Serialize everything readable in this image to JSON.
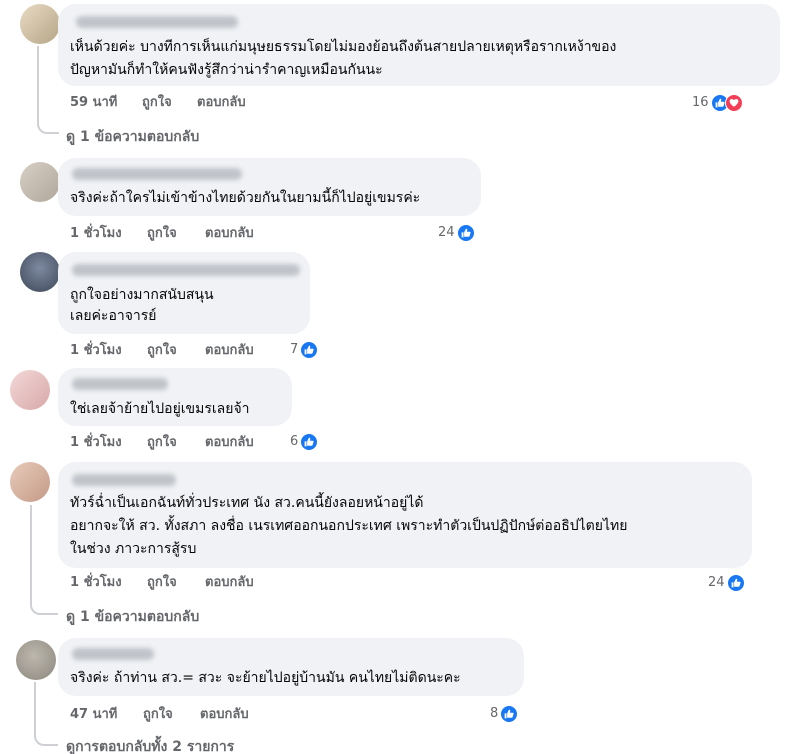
{
  "comments": [
    {
      "avatar_color": "#c9b89a",
      "lines": [
        "เห็นด้วยค่ะ บางทีการเห็นแก่มนุษยธรรมโดยไม่มองย้อนถึงต้นสายปลายเหตุหรือรากเหง้าของ",
        "ปัญหามันก็ทำให้คนฟังรู้สึกว่าน่ารำคาญเหมือนกันนะ"
      ],
      "time": "59 นาที",
      "like": "ถูกใจ",
      "reply": "ตอบกลับ",
      "count": "16",
      "icons": [
        "like-icon",
        "love-icon"
      ],
      "replies_link": "ดู 1 ข้อความตอบกลับ"
    },
    {
      "avatar_color": "#c7bdb2",
      "lines": [
        "จริงค่ะถ้าใครไม่เข้าข้างไทยด้วยกันในยามนี้ก็ไปอยู่เขมรค่ะ"
      ],
      "time": "1 ชั่วโมง",
      "like": "ถูกใจ",
      "reply": "ตอบกลับ",
      "count": "24",
      "icons": [
        "like-icon"
      ]
    },
    {
      "avatar_color": "#5a6478",
      "lines": [
        "ถูกใจอย่างมากสนับสนุน",
        "เลยค่ะอาจารย์"
      ],
      "time": "1 ชั่วโมง",
      "like": "ถูกใจ",
      "reply": "ตอบกลับ",
      "count": "7",
      "icons": [
        "like-icon"
      ]
    },
    {
      "avatar_color": "#e8c4c4",
      "lines": [
        "ใช่เลยจ้าย้ายไปอยู่เขมรเลยจ้า"
      ],
      "time": "1 ชั่วโมง",
      "like": "ถูกใจ",
      "reply": "ตอบกลับ",
      "count": "6",
      "icons": [
        "like-icon"
      ]
    },
    {
      "avatar_color": "#d8b8a8",
      "lines": [
        "ทัวร์ฉ่ำเป็นเอกฉันท์ทั่วประเทศ นัง สว.คนนี้ยังลอยหน้าอยู่ได้",
        "อยากจะให้ สว. ทั้งสภา ลงชื่อ เนรเทศออกนอกประเทศ เพราะทำตัวเป็นปฏิปักษ์ต่ออธิปไตยไทย",
        "ในช่วง ภาวะการสู้รบ"
      ],
      "time": "1 ชั่วโมง",
      "like": "ถูกใจ",
      "reply": "ตอบกลับ",
      "count": "24",
      "icons": [
        "like-icon"
      ],
      "replies_link": "ดู 1 ข้อความตอบกลับ"
    },
    {
      "avatar_color": "#a8a49c",
      "lines": [
        "จริงค่ะ ถ้าท่าน สว.= สวะ จะย้ายไปอยู่บ้านมัน คนไทยไม่ติดนะคะ"
      ],
      "time": "47 นาที",
      "like": "ถูกใจ",
      "reply": "ตอบกลับ",
      "count": "8",
      "icons": [
        "like-icon"
      ],
      "replies_link": "ดูการตอบกลับทั้ง 2 รายการ"
    }
  ],
  "colors": {
    "bubble": "#f0f2f5",
    "meta": "#65676b",
    "like": "#1877f2",
    "love": "#f33e58"
  }
}
